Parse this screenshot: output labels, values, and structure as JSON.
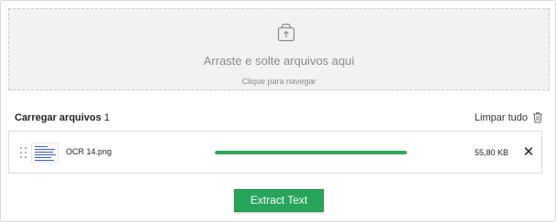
{
  "colors": {
    "accent": "#27a659",
    "progress": "#2aa85a",
    "dropzone_bg": "#f2f2f2"
  },
  "dropzone": {
    "icon": "upload-box-icon",
    "title": "Arraste e solte arquivos aqui",
    "subtitle": "Clique para navegar"
  },
  "uploads": {
    "title": "Carregar arquivos",
    "count": "1",
    "clear_label": "Limpar tudo",
    "clear_icon": "trash-icon"
  },
  "files": [
    {
      "name": "OCR 14.png",
      "size": "55,80 KB",
      "progress_percent": 100,
      "remove_icon": "close-icon",
      "drag_icon": "drag-handle-icon"
    }
  ],
  "actions": {
    "extract_label": "Extract Text"
  }
}
